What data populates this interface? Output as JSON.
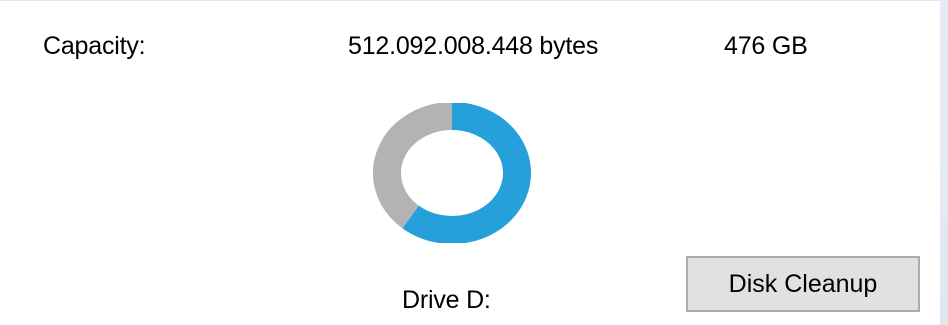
{
  "capacity": {
    "label": "Capacity:",
    "bytes": "512.092.008.448 bytes",
    "gb": "476 GB"
  },
  "usage_chart": {
    "used_fraction": 0.61,
    "used_color": "#26a0da",
    "free_color": "#b3b3b3"
  },
  "drive": {
    "label": "Drive D:"
  },
  "actions": {
    "disk_cleanup_label": "Disk Cleanup"
  }
}
